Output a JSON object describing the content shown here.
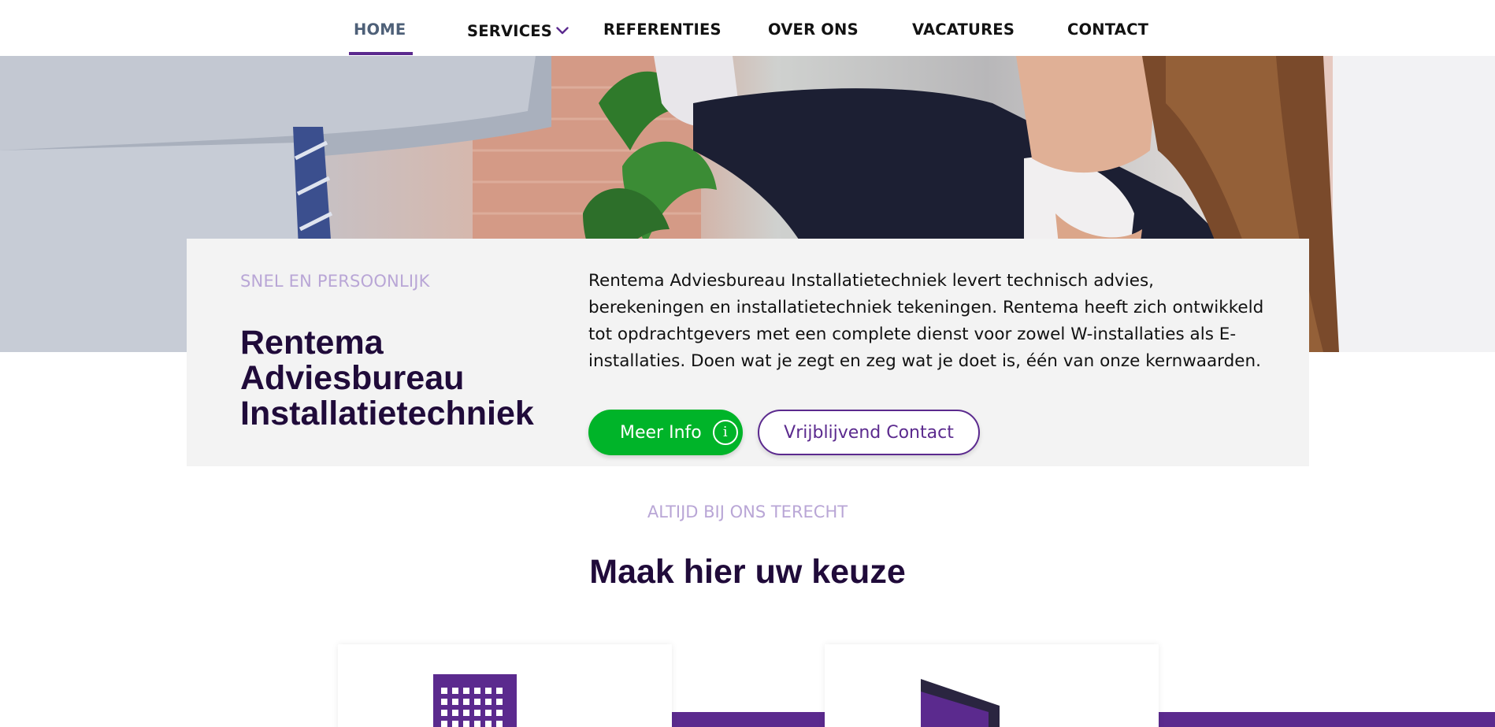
{
  "nav": {
    "items": [
      {
        "label": "HOME",
        "active": true
      },
      {
        "label": "SERVICES",
        "has_dropdown": true
      },
      {
        "label": "REFERENTIES"
      },
      {
        "label": "OVER ONS"
      },
      {
        "label": "VACATURES"
      },
      {
        "label": "CONTACT"
      }
    ],
    "dropdown_icon": "chevron-down-icon"
  },
  "hero": {
    "kicker": "SNEL EN PERSOONLIJK",
    "title": "Rentema Adviesbureau Installatietechniek",
    "description": "Rentema Adviesbureau Installatietechniek levert technisch advies, berekeningen en installatietechniek tekeningen. Rentema heeft zich ontwikkeld tot opdrachtgevers met een complete dienst voor zowel W-installaties als E-installaties. Doen wat je zegt en zeg wat je doet is, één van onze kernwaarden.",
    "primary_button": {
      "label": "Meer Info",
      "icon": "info-icon"
    },
    "secondary_button": {
      "label": "Vrijblijvend Contact"
    }
  },
  "choices": {
    "kicker": "ALTIJD BIJ ONS TERECHT",
    "title": "Maak hier uw keuze",
    "cards": [
      {
        "icon": "building-icon"
      },
      {
        "icon": "document-icon"
      }
    ]
  },
  "colors": {
    "brand_purple": "#5b2a8e",
    "dark_purple": "#200b3a",
    "light_purple": "#b9a6d6",
    "green": "#00b429",
    "card_bg": "#f3f3f3",
    "nav_active": "#4e6078"
  }
}
